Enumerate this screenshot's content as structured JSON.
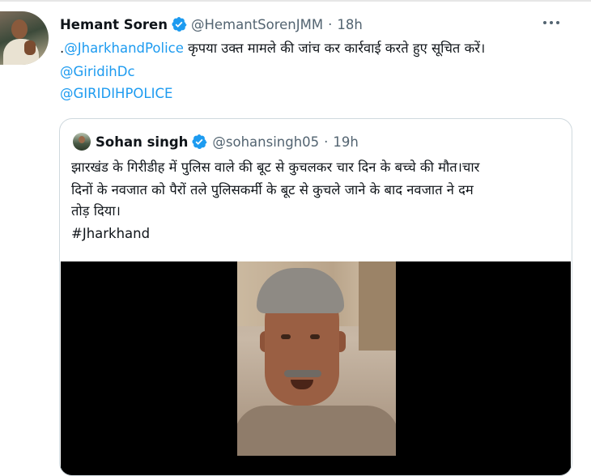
{
  "tweet": {
    "author_name": "Hemant Soren",
    "verified_icon": "verified-badge-icon",
    "handle": "@HemantSorenJMM",
    "separator": "·",
    "time": "18h",
    "more_icon": "more-options-icon",
    "line1_prefix": ".",
    "line1_mention": "@JharkhandPolice",
    "line1_text": " कृपया उक्त मामले की जांच कर कार्रवाई करते हुए सूचित करें।",
    "mention2": "@GiridihDc",
    "mention3": "@GIRIDIHPOLICE"
  },
  "quoted": {
    "author_name": "Sohan singh",
    "verified_icon": "verified-badge-icon",
    "handle": "@sohansingh05",
    "separator": "·",
    "time": "19h",
    "line1": "झारखंड के गिरीडीह में पुलिस वाले की बूट से कुचलकर चार दिन के बच्चे की मौत।चार",
    "line2": "दिनों के नवजात को पैरों तले पुलिसकर्मी के बूट से कुचले जाने के बाद नवजात ने दम",
    "line3": "तोड़ दिया।",
    "hashtag": "#Jharkhand"
  },
  "colors": {
    "link": "#1d9bf0",
    "secondary_text": "#536471",
    "primary_text": "#0f1419",
    "verified": "#1d9bf0",
    "border": "#cfd9de"
  }
}
